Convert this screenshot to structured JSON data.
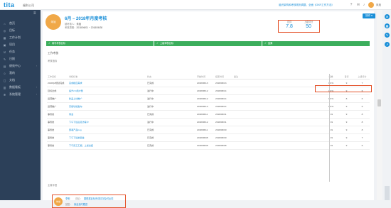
{
  "topbar": {
    "logo": "tita",
    "company": "福利公司",
    "link": "组织架构和考核规则调整，全面《OKR工作方法》",
    "user": "朱旭"
  },
  "sidebar": {
    "items": [
      {
        "label": "首页",
        "icon": "home-icon"
      },
      {
        "label": "目标",
        "icon": "target-icon"
      },
      {
        "label": "工作计划",
        "icon": "calendar-icon"
      },
      {
        "label": "项目",
        "icon": "project-icon"
      },
      {
        "label": "任务",
        "icon": "task-icon"
      },
      {
        "label": "日报",
        "icon": "report-icon"
      },
      {
        "label": "绩效中心",
        "icon": "chart-icon",
        "arrow": "›"
      },
      {
        "label": "我的",
        "icon": "user-icon"
      },
      {
        "label": "文档",
        "icon": "doc-icon"
      },
      {
        "label": "数据看板",
        "icon": "board-icon",
        "arrow": "›"
      },
      {
        "label": "系统管理",
        "icon": "gear-icon",
        "arrow": "›"
      }
    ]
  },
  "header": {
    "avatar_text": "朱旭",
    "title": "6月 – 2018年月度考核",
    "meta1_label": "被考核人：",
    "meta1_value": "朱旭",
    "meta2_label": "考核周期：",
    "meta2_value": "2018/06/01 ~ 2018/06/30",
    "score1_label": "自评",
    "score1_value": "7.8",
    "score2_label": "上级评分",
    "score2_value": "50",
    "action_button": "操作 ▾"
  },
  "steps": [
    {
      "label": "填写考核目标"
    },
    {
      "label": "上级审核目标"
    },
    {
      "label": "结果"
    }
  ],
  "section_title": "工作考核",
  "subsection_title": "考核指标",
  "table": {
    "headers": [
      "工作目标",
      "考核标准",
      "",
      "",
      "",
      "状态",
      "开始时间",
      "结束时间",
      "备注",
      "",
      "",
      "权重",
      "自评",
      "上级评分"
    ],
    "rows": [
      [
        "2018Q2规划完成",
        "完成相应需求",
        "已完成",
        "2018/06/13",
        "2018/06/13",
        "",
        "10 %",
        "9",
        "7"
      ],
      [
        "目标达成",
        "提升2.0用户量",
        "进行中",
        "2018/06/12",
        "2018/06/14",
        "",
        "10 %",
        "9",
        "6"
      ],
      [
        "运营推广",
        "新品上线推广",
        "进行中",
        "2018/06/12",
        "2018/06/14",
        "",
        "10 %",
        "8",
        "6"
      ],
      [
        "运营推广",
        "高级功能发布",
        "进行中",
        "2018/06/13",
        "2018/06/14",
        "",
        "10 %",
        "9",
        "6"
      ],
      [
        "事务类",
        "例会",
        "已完成",
        "2018/06/11",
        "2018/06/31",
        "",
        "5 %",
        "9",
        "8"
      ],
      [
        "事务类",
        "下午下班后走访客户",
        "进行中",
        "2018/06/12",
        "2018/06/31",
        "",
        "5 %",
        "9",
        "8"
      ],
      [
        "事务类",
        "部署产品bug",
        "已完成",
        "2018/06/11",
        "2018/06/30",
        "",
        "5 %",
        "9",
        "8"
      ],
      [
        "事务类",
        "下午下班前复盘",
        "已完成",
        "2018/06/08",
        "2018/06/30",
        "",
        "5 %",
        "9",
        "7"
      ],
      [
        "事务类",
        "下午员工汇报、上述总结",
        "已完成",
        "2018/06/08",
        "2018/06/08",
        "",
        "5 %",
        "9",
        "6"
      ]
    ]
  },
  "comments": {
    "section": "主管评语",
    "avatar_text": "朱旭",
    "line1_name": "李明",
    "line1_label": "评论：",
    "line1_text": "要根据目标完成情况及时反馈",
    "line2_label": "回复：",
    "line2_text": "我会及时跟进"
  },
  "colors": {
    "accent": "#1a8fd8",
    "sidebar": "#2c4059",
    "progress": "#3cae5c",
    "highlight": "#e4542c",
    "avatar": "#f0a848"
  }
}
